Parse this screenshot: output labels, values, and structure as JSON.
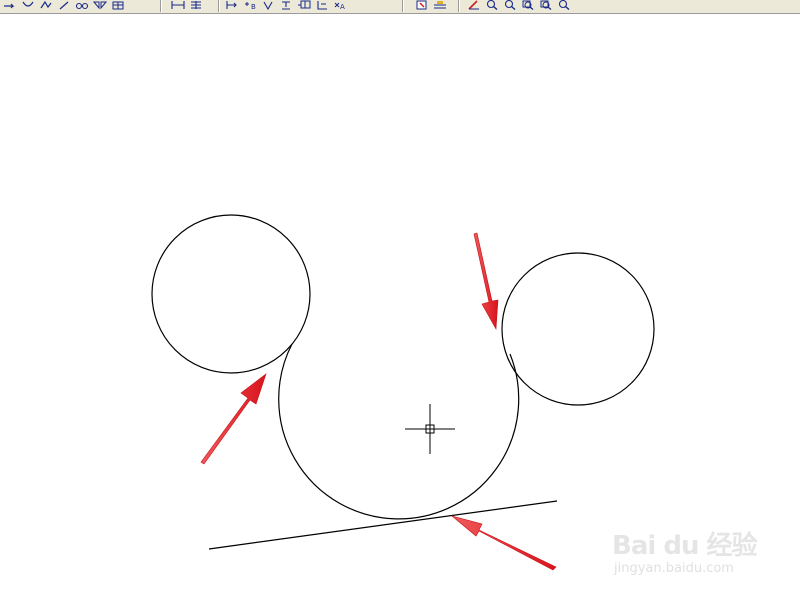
{
  "toolbar": {
    "groups": [
      {
        "icons": [
          "line-icon",
          "spline-icon",
          "polyline-icon",
          "arc-icon",
          "offset-icon",
          "mirror-icon",
          "move-icon"
        ]
      },
      {
        "icons": [
          "dimension-linear-icon",
          "dimension-aligned-icon"
        ]
      },
      {
        "icons": [
          "insert-block-icon",
          "point-icon",
          "hatch-icon",
          "text-icon",
          "table-icon",
          "leader-icon",
          "attribute-icon"
        ]
      },
      {
        "icons": [
          "properties-icon",
          "layer-icon"
        ]
      },
      {
        "icons": [
          "pencil-icon",
          "zoom-realtime-icon",
          "zoom-window-icon",
          "zoom-extents-icon",
          "zoom-previous-icon",
          "zoom-out-icon"
        ]
      }
    ]
  },
  "drawing": {
    "stroke_color": "#000000",
    "annotation_arrow_color": "#e8222a",
    "cursor_color": "#000000"
  },
  "watermark": {
    "brand": "Bai du 经验",
    "url": "jingyan.baidu.com"
  }
}
